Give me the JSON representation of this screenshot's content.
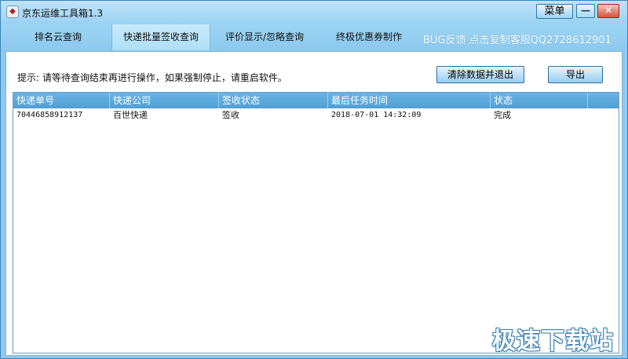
{
  "window": {
    "title": "京东运维工具箱1.3",
    "menu_label": "菜单",
    "minimize_glyph": "—",
    "close_glyph": "✕",
    "app_icon": "app-logo-icon",
    "app_icon_glyph": "◆"
  },
  "tabs": [
    {
      "label": "排名云查询"
    },
    {
      "label": "快递批量签收查询"
    },
    {
      "label": "评价显示/忽略查询"
    },
    {
      "label": "终极优惠券制作"
    }
  ],
  "active_tab": 1,
  "feedback": "BUG反馈  点击复制客服QQ2728612901",
  "panel": {
    "hint": "提示: 请等待查询结束再进行操作，如果强制停止，请重启软件。",
    "clear_button": "清除数据并退出",
    "export_button": "导出"
  },
  "table": {
    "columns": [
      "快递单号",
      "快递公司",
      "签收状态",
      "最后任务时间",
      "状态"
    ],
    "rows": [
      [
        "70446858912137",
        "百世快递",
        "签收",
        "2018-07-01 14:32:09",
        "完成"
      ]
    ]
  },
  "watermark": "极速下载站",
  "colors": {
    "titlebar": "#a6d8f4",
    "tabbar": "#92cdf0",
    "grid_header": "#5aa8dc",
    "close_button": "#d6533c"
  }
}
